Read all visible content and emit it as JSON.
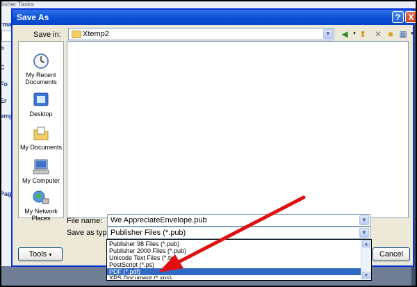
{
  "background_app": {
    "taskpane_title": "lisher Tasks",
    "side_labels": [
      "rmat",
      "P",
      "C",
      "Fo",
      "Er",
      "emp",
      "Page"
    ]
  },
  "dialog": {
    "title": "Save As",
    "help_label": "?",
    "close_label": "X",
    "save_in": {
      "label": "Save in:",
      "value": "Xtemp2"
    },
    "toolbar_icons": [
      "back-icon",
      "up-folder-icon",
      "delete-icon",
      "new-folder-icon",
      "views-icon"
    ],
    "places": [
      {
        "label": "My Recent Documents",
        "icon": "recent-documents-icon"
      },
      {
        "label": "Desktop",
        "icon": "desktop-icon"
      },
      {
        "label": "My Documents",
        "icon": "my-documents-icon"
      },
      {
        "label": "My Computer",
        "icon": "my-computer-icon"
      },
      {
        "label": "My Network Places",
        "icon": "network-places-icon"
      }
    ],
    "file_name": {
      "label": "File name:",
      "value": "We AppreciateEnvelope.pub"
    },
    "save_as_type": {
      "label": "Save as type:",
      "value": "Publisher Files (*.pub)",
      "options": [
        "Publisher 98 Files (*.pub)",
        "Publisher 2000 Files (*.pub)",
        "Unicode Text Files (*.txt)",
        "PostScript (*.ps)",
        "PDF (*.pdf)",
        "XPS Document (*.xps)"
      ],
      "selected_option": "PDF (*.pdf)"
    },
    "tools_button": "Tools",
    "cancel_button": "Cancel"
  },
  "colors": {
    "titlebar": "#0a4fd8",
    "dialog_face": "#ece9d8",
    "selection": "#316ac5",
    "annotation_arrow": "#e01010"
  }
}
